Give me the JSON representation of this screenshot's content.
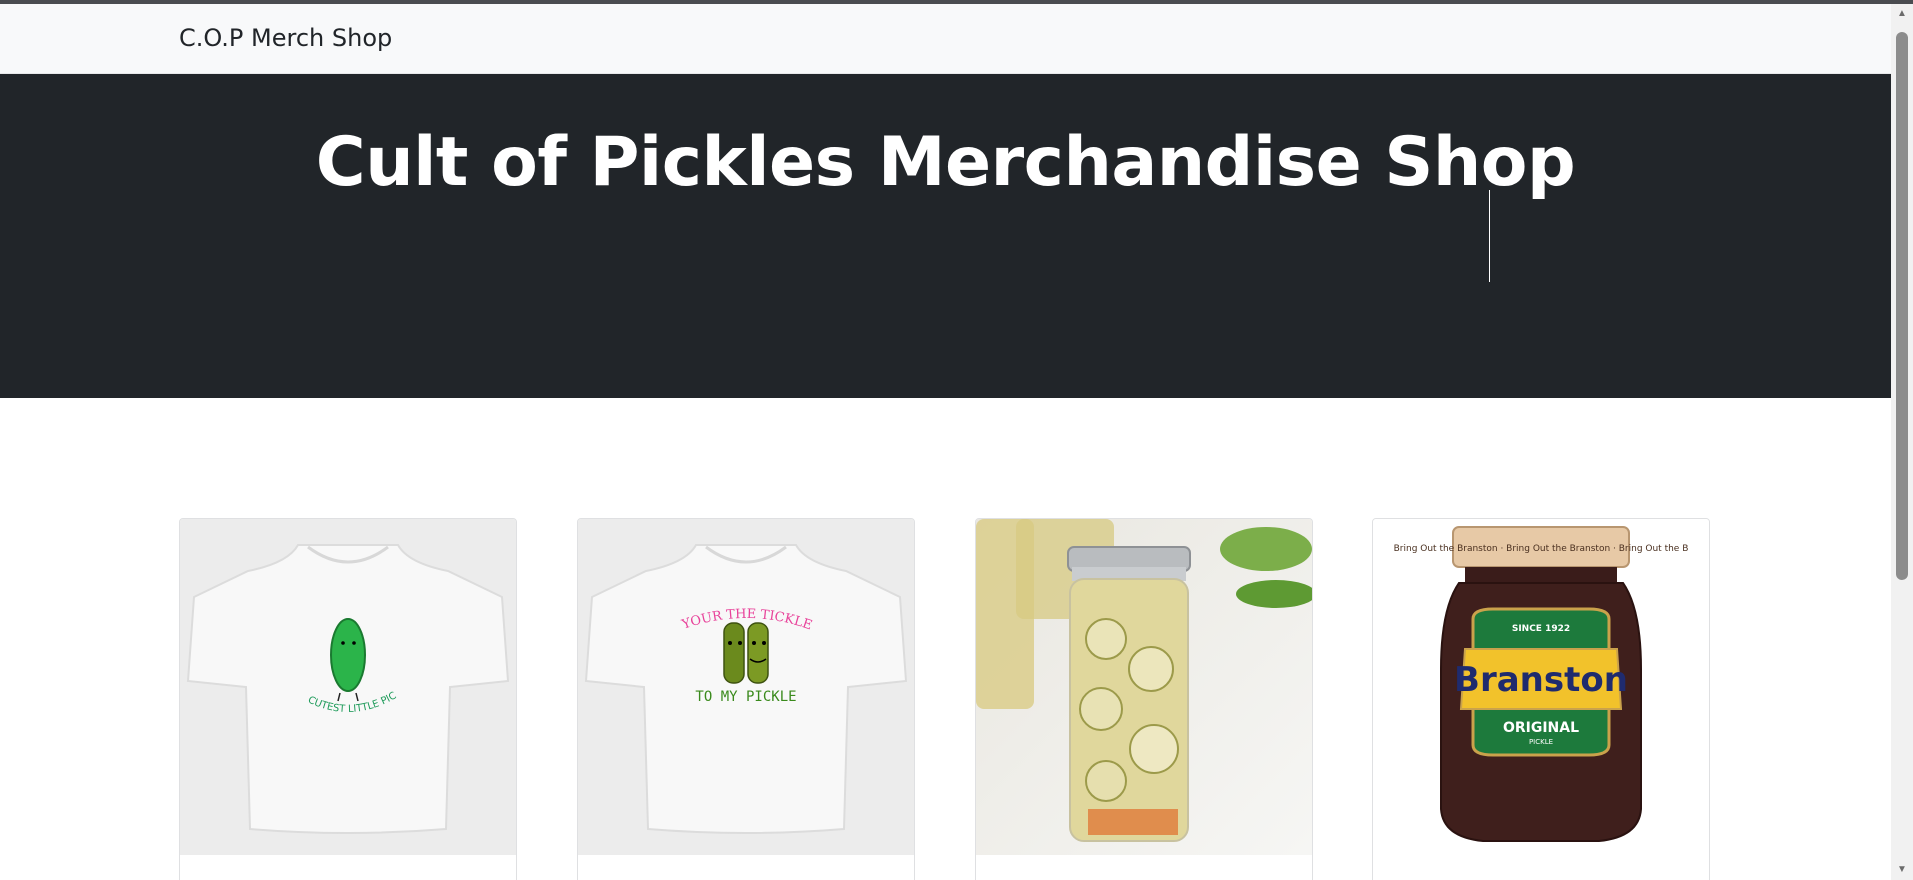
{
  "navbar": {
    "brand": "C.O.P Merch Shop"
  },
  "hero": {
    "title": "Cult of Pickles Merchandise Shop"
  },
  "products": [
    {
      "image": "tshirt-cutest-little-pickle",
      "shirt_text": "CUTEST LITTLE PICKLE"
    },
    {
      "image": "tshirt-tickle-to-my-pickle",
      "shirt_text_top": "YOUR THE TICKLE",
      "shirt_text_bottom": "TO MY PICKLE"
    },
    {
      "image": "jar-of-pickle-slices"
    },
    {
      "image": "branston-pickle-jar",
      "label_since": "SINCE 1922",
      "label_brand": "Branston",
      "label_original": "ORIGINAL",
      "label_pickle": "PICKLE",
      "lid_text": "Bring Out the Branston · Bring Out the Branston · Bring Out the B"
    }
  ],
  "scrollbar": {
    "up_icon": "triangle-up-icon",
    "down_icon": "triangle-down-icon"
  },
  "colors": {
    "hero_bg": "#212529",
    "navbar_bg": "#f8f9fa"
  }
}
